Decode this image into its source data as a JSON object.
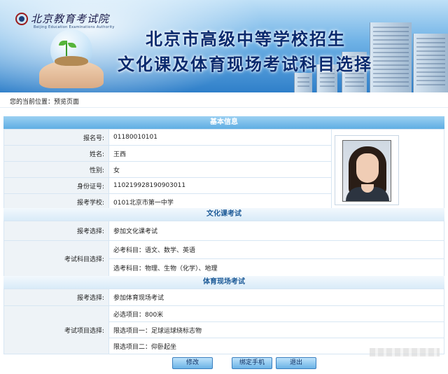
{
  "banner": {
    "logo_text": "北京教育考试院",
    "logo_sub": "Beijing Education Examinations Authority",
    "title_line1": "北京市高级中等学校招生",
    "title_line2": "文化课及体育现场考试科目选择"
  },
  "breadcrumb": "您的当前位置：预览页面",
  "basic": {
    "header": "基本信息",
    "rows": [
      {
        "label": "报名号:",
        "value": "01180010101"
      },
      {
        "label": "姓名:",
        "value": "王西"
      },
      {
        "label": "性别:",
        "value": "女"
      },
      {
        "label": "身份证号:",
        "value": "110219928190903011"
      },
      {
        "label": "报考学校:",
        "value": "0101北京市第一中学"
      }
    ]
  },
  "culture": {
    "header": "文化课考试",
    "choice_label": "报考选择:",
    "choice_value": "参加文化课考试",
    "subjects_label": "考试科目选择:",
    "required": "必考科目：语文、数学、英语",
    "elective": "选考科目：物理、生物（化学）、地理"
  },
  "sports": {
    "header": "体育现场考试",
    "choice_label": "报考选择:",
    "choice_value": "参加体育现场考试",
    "items_label": "考试项目选择:",
    "item1": "必选项目：800米",
    "item2": "限选项目一：足球运球绕标志物",
    "item3": "限选项目二：仰卧起坐"
  },
  "buttons": {
    "edit": "修改",
    "bind_phone": "绑定手机",
    "exit": "退出"
  },
  "colors": {
    "header_blue": "#5faee3",
    "label_bg": "#eef3f7"
  }
}
